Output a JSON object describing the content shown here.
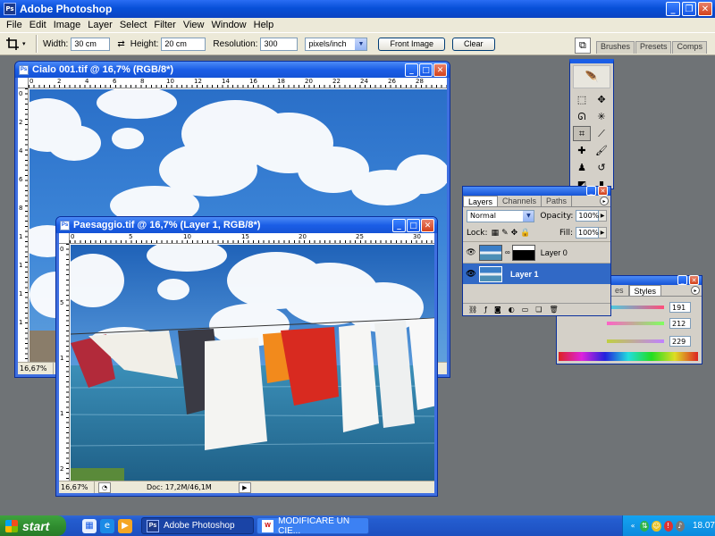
{
  "app": {
    "title": "Adobe Photoshop",
    "logo": "Ps"
  },
  "window_buttons": {
    "minimize": "_",
    "restore": "❐",
    "close": "✕"
  },
  "menu": [
    "File",
    "Edit",
    "Image",
    "Layer",
    "Select",
    "Filter",
    "View",
    "Window",
    "Help"
  ],
  "options": {
    "tool_icon": "crop-icon",
    "width_label": "Width:",
    "width_value": "30 cm",
    "height_label": "Height:",
    "height_value": "20 cm",
    "resolution_label": "Resolution:",
    "resolution_value": "300",
    "units": "pixels/inch",
    "front_image": "Front Image",
    "clear": "Clear"
  },
  "palette_well": {
    "tabs": [
      "Brushes",
      "Presets",
      "Comps"
    ]
  },
  "doc1": {
    "title": "Cialo 001.tif @ 16,7% (RGB/8*)",
    "zoom": "16,67%",
    "ruler_h": [
      "0",
      "2",
      "4",
      "6",
      "8",
      "10",
      "12",
      "14",
      "16",
      "18",
      "20",
      "22",
      "24",
      "26",
      "28"
    ],
    "ruler_v": [
      "0",
      "2",
      "4",
      "6",
      "8",
      "1",
      "1",
      "1",
      "1"
    ]
  },
  "doc2": {
    "title": "Paesaggio.tif @ 16,7% (Layer 1, RGB/8*)",
    "zoom": "16,67%",
    "doc_info": "Doc: 17,2M/46,1M",
    "ruler_h": [
      "0",
      "5",
      "10",
      "15",
      "20",
      "25",
      "30"
    ],
    "ruler_v": [
      "0",
      "5",
      "1",
      "1",
      "2"
    ]
  },
  "layers_panel": {
    "tabs": [
      "Layers",
      "Channels",
      "Paths"
    ],
    "blend_mode": "Normal",
    "opacity_label": "Opacity:",
    "opacity_value": "100%",
    "lock_label": "Lock:",
    "fill_label": "Fill:",
    "fill_value": "100%",
    "layers": [
      {
        "name": "Layer 0",
        "selected": false
      },
      {
        "name": "Layer 1",
        "selected": true
      }
    ]
  },
  "color_panel": {
    "tabs": [
      "es",
      "Styles"
    ],
    "r": "191",
    "g": "212",
    "b": "229"
  },
  "taskbar": {
    "start": "start",
    "tasks": [
      {
        "label": "Adobe Photoshop",
        "active": true
      },
      {
        "label": "MODIFICARE UN CIE...",
        "active": false
      }
    ],
    "clock": "18.07"
  }
}
